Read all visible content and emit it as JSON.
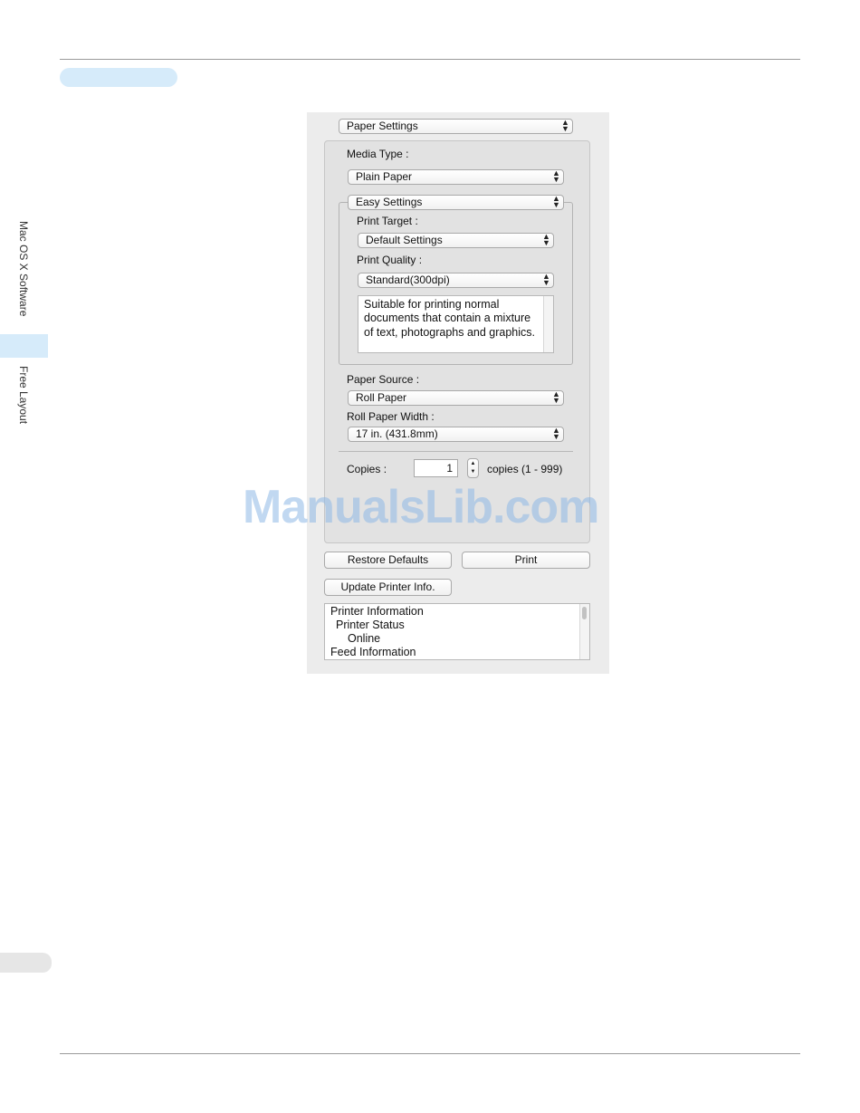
{
  "sidebar": {
    "section_label": "Mac OS X Software",
    "subsection_label": "Free Layout"
  },
  "dialog": {
    "panel_select": "Paper Settings",
    "media_type_label": "Media Type :",
    "media_type_value": "Plain Paper",
    "settings_mode": "Easy Settings",
    "print_target_label": "Print Target :",
    "print_target_value": "Default Settings",
    "print_quality_label": "Print Quality :",
    "print_quality_value": "Standard(300dpi)",
    "quality_description": "Suitable for printing normal documents that contain a mixture of text, photographs and graphics.",
    "paper_source_label": "Paper Source :",
    "paper_source_value": "Roll Paper",
    "roll_width_label": "Roll Paper Width :",
    "roll_width_value": "17 in. (431.8mm)",
    "copies_label": "Copies :",
    "copies_value": "1",
    "copies_range": "copies (1 - 999)",
    "restore_defaults_label": "Restore Defaults",
    "print_label": "Print",
    "update_printer_label": "Update Printer Info.",
    "printer_info": {
      "line1": "Printer Information",
      "line2": "Printer Status",
      "line3": "Online",
      "line4": "Feed Information"
    }
  },
  "watermark": "ManualsLib.com",
  "colors": {
    "accent_tab": "#d6ebfa",
    "panel_bg": "#ececec"
  }
}
